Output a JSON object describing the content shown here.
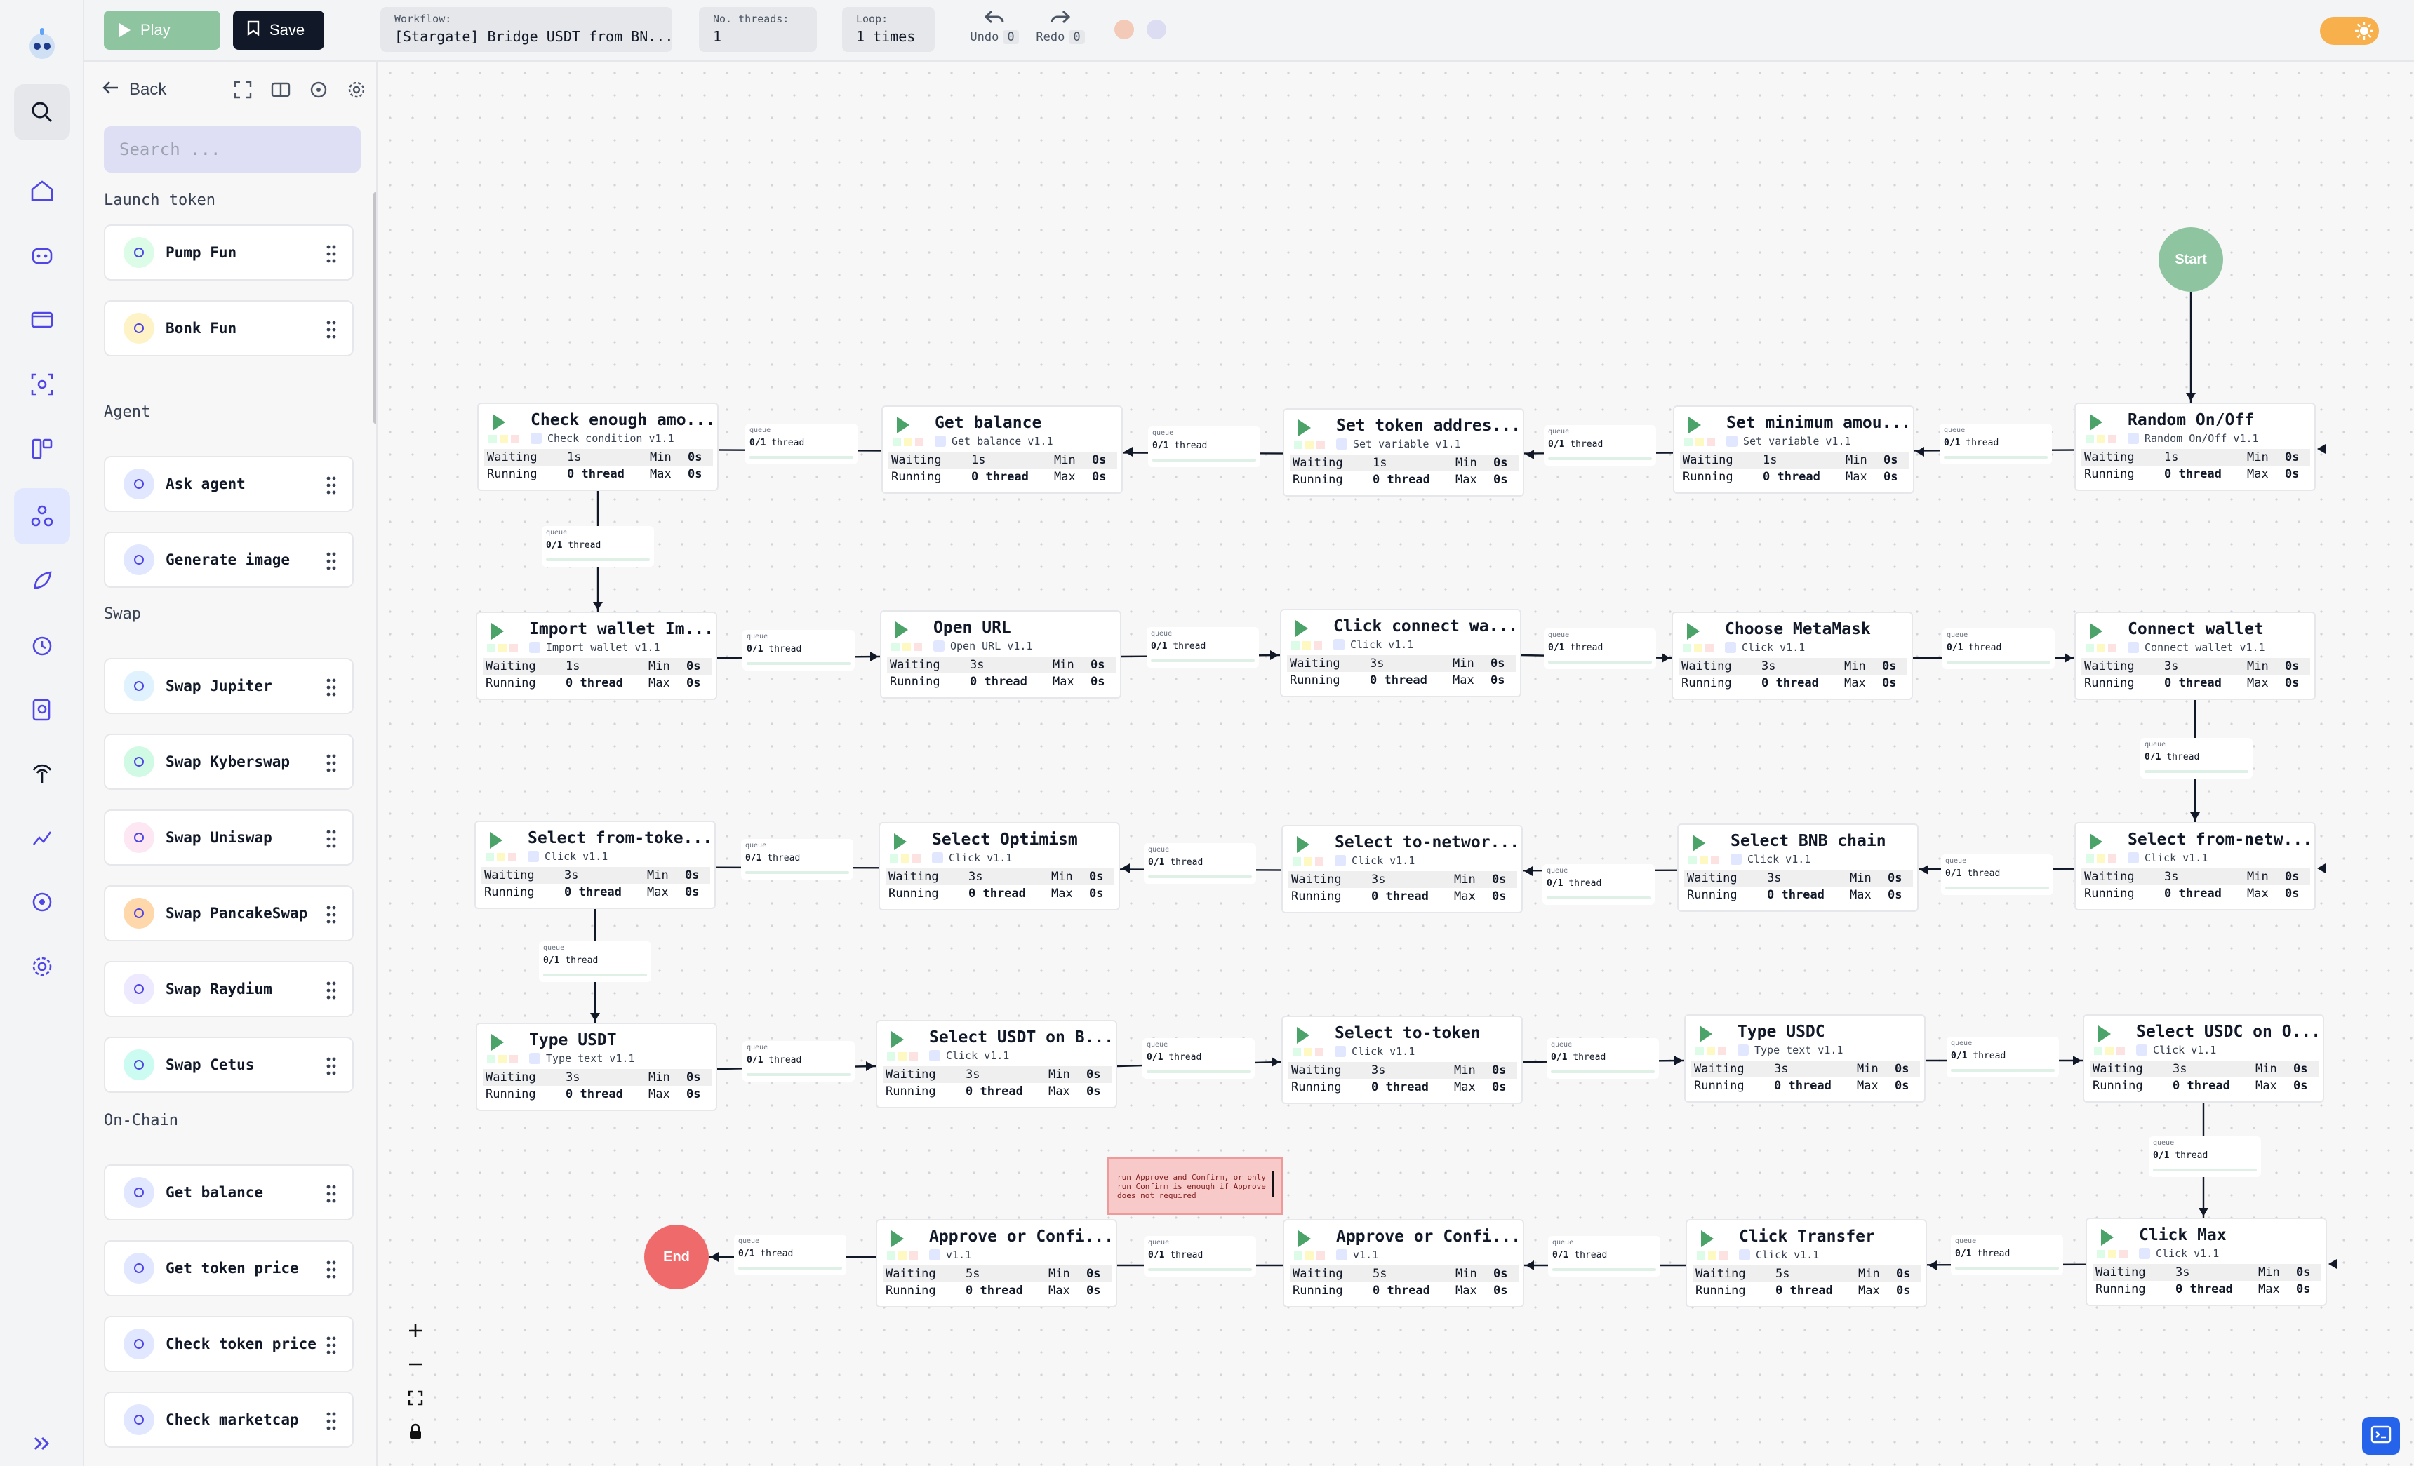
{
  "app": {
    "accent": "#4f46e5",
    "start_color": "#8ec5a0",
    "end_color": "#ef6b6b"
  },
  "topbar": {
    "play_label": "Play",
    "save_label": "Save",
    "workflow_label": "Workflow:",
    "workflow_value": "[Stargate] Bridge USDT from BN...",
    "threads_label": "No. threads:",
    "threads_value": "1",
    "loop_label": "Loop:",
    "loop_value": "1 times",
    "undo_label": "Undo",
    "undo_count": "0",
    "redo_label": "Redo",
    "redo_count": "0"
  },
  "rail": {
    "icons": [
      "search-icon",
      "home-icon",
      "bot-icon",
      "wallet-icon",
      "image-scan-icon",
      "layout-icon",
      "workflow-icon",
      "rocket-icon",
      "alarm-icon",
      "search-doc-icon",
      "antenna-icon",
      "chart-icon",
      "target-icon",
      "settings-icon"
    ]
  },
  "panel": {
    "back_label": "Back",
    "search_placeholder": "Search ...",
    "sections": [
      {
        "title": "Launch token",
        "items": [
          "Pump Fun",
          "Bonk Fun"
        ]
      },
      {
        "title": "Agent",
        "items": [
          "Ask agent",
          "Generate image"
        ]
      },
      {
        "title": "Swap",
        "items": [
          "Swap Jupiter",
          "Swap Kyberswap",
          "Swap Uniswap",
          "Swap PancakeSwap",
          "Swap Raydium",
          "Swap Cetus"
        ]
      },
      {
        "title": "On-Chain",
        "items": [
          "Get balance",
          "Get token price",
          "Check token price",
          "Check marketcap"
        ]
      }
    ]
  },
  "canvas": {
    "start_label": "Start",
    "end_label": "End",
    "queue_label": "queue",
    "queue_value": "0/1",
    "queue_unit": "thread",
    "stat_labels": {
      "waiting": "Waiting",
      "running": "Running",
      "min": "Min",
      "max": "Max"
    },
    "note": "run Approve and Confirm, or only run Confirm is enough if Approve does not required",
    "nodes": [
      {
        "title": "Check enough amo...",
        "sub": "Check condition v1.1",
        "wait": "1s",
        "run": "0 thread",
        "min": "0s",
        "max": "0s"
      },
      {
        "title": "Get balance",
        "sub": "Get balance v1.1",
        "wait": "1s",
        "run": "0 thread",
        "min": "0s",
        "max": "0s"
      },
      {
        "title": "Set token addres...",
        "sub": "Set variable v1.1",
        "wait": "1s",
        "run": "0 thread",
        "min": "0s",
        "max": "0s"
      },
      {
        "title": "Set minimum amou...",
        "sub": "Set variable v1.1",
        "wait": "1s",
        "run": "0 thread",
        "min": "0s",
        "max": "0s"
      },
      {
        "title": "Random On/Off",
        "sub": "Random On/Off v1.1",
        "wait": "1s",
        "run": "0 thread",
        "min": "0s",
        "max": "0s"
      },
      {
        "title": "Import wallet Im...",
        "sub": "Import wallet v1.1",
        "wait": "1s",
        "run": "0 thread",
        "min": "0s",
        "max": "0s"
      },
      {
        "title": "Open URL",
        "sub": "Open URL v1.1",
        "wait": "3s",
        "run": "0 thread",
        "min": "0s",
        "max": "0s"
      },
      {
        "title": "Click connect wa...",
        "sub": "Click v1.1",
        "wait": "3s",
        "run": "0 thread",
        "min": "0s",
        "max": "0s"
      },
      {
        "title": "Choose MetaMask",
        "sub": "Click v1.1",
        "wait": "3s",
        "run": "0 thread",
        "min": "0s",
        "max": "0s"
      },
      {
        "title": "Connect wallet",
        "sub": "Connect wallet v1.1",
        "wait": "3s",
        "run": "0 thread",
        "min": "0s",
        "max": "0s"
      },
      {
        "title": "Select from-toke...",
        "sub": "Click v1.1",
        "wait": "3s",
        "run": "0 thread",
        "min": "0s",
        "max": "0s"
      },
      {
        "title": "Select Optimism",
        "sub": "Click v1.1",
        "wait": "3s",
        "run": "0 thread",
        "min": "0s",
        "max": "0s"
      },
      {
        "title": "Select to-networ...",
        "sub": "Click v1.1",
        "wait": "3s",
        "run": "0 thread",
        "min": "0s",
        "max": "0s"
      },
      {
        "title": "Select BNB chain",
        "sub": "Click v1.1",
        "wait": "3s",
        "run": "0 thread",
        "min": "0s",
        "max": "0s"
      },
      {
        "title": "Select from-netw...",
        "sub": "Click v1.1",
        "wait": "3s",
        "run": "0 thread",
        "min": "0s",
        "max": "0s"
      },
      {
        "title": "Type USDT",
        "sub": "Type text v1.1",
        "wait": "3s",
        "run": "0 thread",
        "min": "0s",
        "max": "0s"
      },
      {
        "title": "Select USDT on B...",
        "sub": "Click v1.1",
        "wait": "3s",
        "run": "0 thread",
        "min": "0s",
        "max": "0s"
      },
      {
        "title": "Select to-token",
        "sub": "Click v1.1",
        "wait": "3s",
        "run": "0 thread",
        "min": "0s",
        "max": "0s"
      },
      {
        "title": "Type USDC",
        "sub": "Type text v1.1",
        "wait": "3s",
        "run": "0 thread",
        "min": "0s",
        "max": "0s"
      },
      {
        "title": "Select USDC on O...",
        "sub": "Click v1.1",
        "wait": "3s",
        "run": "0 thread",
        "min": "0s",
        "max": "0s"
      },
      {
        "title": "Approve or Confi...",
        "sub": "v1.1",
        "wait": "5s",
        "run": "0 thread",
        "min": "0s",
        "max": "0s"
      },
      {
        "title": "Approve or Confi...",
        "sub": "v1.1",
        "wait": "5s",
        "run": "0 thread",
        "min": "0s",
        "max": "0s"
      },
      {
        "title": "Click Transfer",
        "sub": "Click v1.1",
        "wait": "5s",
        "run": "0 thread",
        "min": "0s",
        "max": "0s"
      },
      {
        "title": "Click Max",
        "sub": "Click v1.1",
        "wait": "3s",
        "run": "0 thread",
        "min": "0s",
        "max": "0s"
      }
    ]
  }
}
